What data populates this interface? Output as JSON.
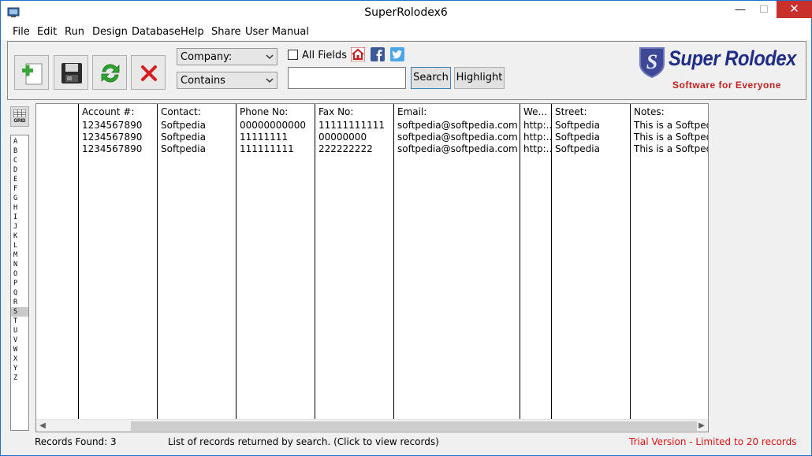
{
  "window": {
    "title": "SuperRolodex6",
    "controls": {
      "minimize": "—",
      "maximize": "☐",
      "close": "✕"
    }
  },
  "menu": [
    "File",
    "Edit",
    "Run",
    "Design",
    "Database",
    "Help",
    "Share",
    "User Manual"
  ],
  "toolbar": {
    "buttons": [
      "add-record-icon",
      "save-icon",
      "refresh-icon",
      "delete-icon"
    ],
    "field_select": "Company:",
    "operator_select": "Contains",
    "all_fields_label": "All Fields",
    "all_fields_checked": false,
    "search_value": "",
    "search_button": "Search",
    "highlight_button": "Highlight",
    "social_icons": [
      "home-icon",
      "facebook-icon",
      "twitter-icon"
    ]
  },
  "logo": {
    "title": "Super Rolodex",
    "subtitle": "Software for Everyone",
    "badge": "S"
  },
  "sidebar": {
    "grid_label": "GRID",
    "letters": [
      "A",
      "B",
      "C",
      "D",
      "E",
      "F",
      "G",
      "H",
      "I",
      "J",
      "K",
      "L",
      "M",
      "N",
      "O",
      "P",
      "Q",
      "R",
      "S",
      "T",
      "U",
      "V",
      "W",
      "X",
      "Y",
      "Z"
    ],
    "selected_letter": "S"
  },
  "table": {
    "columns": [
      "Account #:",
      "Contact:",
      "Phone No:",
      "Fax No:",
      "Email:",
      "We...",
      "Street:",
      "Notes:"
    ],
    "rows": [
      [
        "1234567890",
        "Softpedia",
        "00000000000",
        "11111111111",
        "softpedia@softpedia.com",
        "http:...",
        "Softpedia",
        "This is a Softped..."
      ],
      [
        "1234567890",
        "Softpedia",
        "11111111",
        "00000000",
        "softpedia@softpedia.com",
        "http:...",
        "Softpedia",
        "This is a Softped..."
      ],
      [
        "1234567890",
        "Softpedia",
        "111111111",
        "222222222",
        "softpedia@softpedia.com",
        "http:...",
        "Softpedia",
        "This is a Softped..."
      ]
    ]
  },
  "status": {
    "records_found": "Records Found: 3",
    "message": "List of records returned by search.  (Click to view records)",
    "trial": "Trial Version - Limited to 20 records"
  },
  "colors": {
    "accent": "#1e70c8",
    "logo_blue": "#1f2c88",
    "logo_red": "#c41f1f",
    "trial_red": "#e01010",
    "close_red": "#c7302b"
  }
}
